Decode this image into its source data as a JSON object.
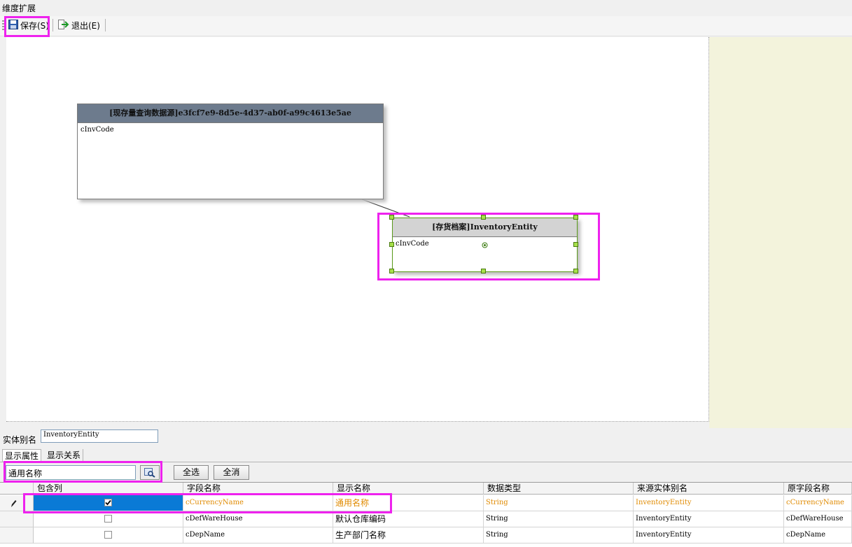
{
  "window": {
    "title": "维度扩展"
  },
  "toolbar": {
    "save_label": "保存(S)",
    "exit_label": "退出(E)"
  },
  "canvas": {
    "source_entity": {
      "title": "[现存量查询数据源]e3fcf7e9-8d5e-4d37-ab0f-a99c4613e5ae",
      "fields": [
        "cInvCode"
      ]
    },
    "target_entity": {
      "title": "[存货档案]InventoryEntity",
      "fields": [
        "cInvCode"
      ]
    }
  },
  "properties": {
    "alias_label": "实体别名",
    "alias_value": "InventoryEntity",
    "tabs": [
      "显示属性",
      "显示关系"
    ],
    "search_value": "通用名称",
    "select_all_label": "全选",
    "deselect_all_label": "全消"
  },
  "grid": {
    "columns": [
      "包含列",
      "字段名称",
      "显示名称",
      "数据类型",
      "来源实体别名",
      "原字段名称"
    ],
    "rows": [
      {
        "included": true,
        "field": "cCurrencyName",
        "display": "通用名称",
        "type": "String",
        "source": "InventoryEntity",
        "original": "cCurrencyName"
      },
      {
        "included": false,
        "field": "cDefWareHouse",
        "display": "默认仓库编码",
        "type": "String",
        "source": "InventoryEntity",
        "original": "cDefWareHouse"
      },
      {
        "included": false,
        "field": "cDepName",
        "display": "生产部门名称",
        "type": "String",
        "source": "InventoryEntity",
        "original": "cDepName"
      }
    ]
  },
  "colors": {
    "highlight": "#ee22ee",
    "selection": "#0a7ad6",
    "selected_text": "#e08a00",
    "source_header": "#6d7b8d",
    "target_header": "#d3d3d3"
  }
}
